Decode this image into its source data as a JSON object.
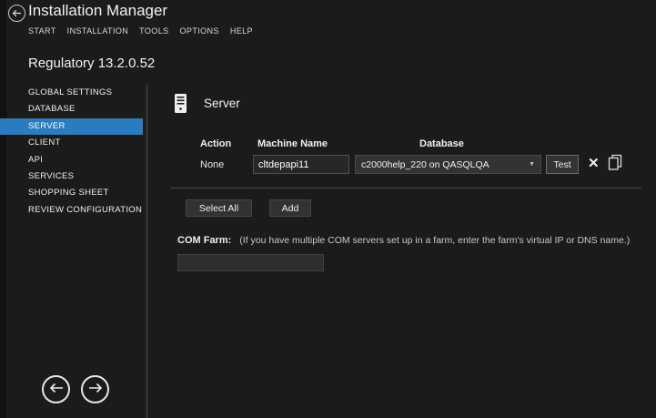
{
  "window": {
    "title": "Installation Manager",
    "menu": [
      "START",
      "INSTALLATION",
      "TOOLS",
      "OPTIONS",
      "HELP"
    ]
  },
  "product": {
    "name": "Regulatory 13.2.0.52"
  },
  "sidebar": {
    "items": [
      {
        "label": "GLOBAL SETTINGS"
      },
      {
        "label": "DATABASE"
      },
      {
        "label": "SERVER"
      },
      {
        "label": "CLIENT"
      },
      {
        "label": "API"
      },
      {
        "label": "SERVICES"
      },
      {
        "label": "SHOPPING SHEET"
      },
      {
        "label": "REVIEW CONFIGURATION"
      }
    ],
    "selected": "SERVER"
  },
  "main": {
    "section_title": "Server",
    "table": {
      "headers": {
        "action": "Action",
        "machine": "Machine Name",
        "database": "Database"
      },
      "row": {
        "action": "None",
        "machine_name": "cltdepapi11",
        "database_selected": "c2000help_220 on QASQLQA",
        "test_label": "Test"
      }
    },
    "buttons": {
      "select_all": "Select All",
      "add": "Add"
    },
    "com_farm": {
      "label": "COM Farm:",
      "hint": "(If you have multiple COM servers set up in a farm, enter the farm's virtual IP or DNS name.)",
      "value": ""
    }
  },
  "icons": {
    "delete": "✕",
    "dropdown_chevron": "▼"
  },
  "colors": {
    "accent": "#2b7cbf",
    "background": "#1b1b1b",
    "divider": "#4a4a4a"
  }
}
